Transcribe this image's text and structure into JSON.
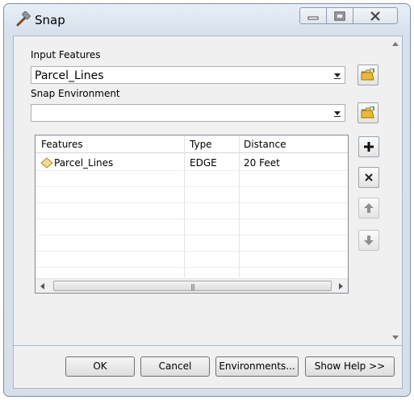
{
  "window": {
    "title": "Snap",
    "icon": "hammer-icon"
  },
  "controls": {
    "minimize": "minimize-icon",
    "maximize": "maximize-icon",
    "close": "close-icon"
  },
  "input_features": {
    "label": "Input Features",
    "value": "Parcel_Lines"
  },
  "snap_environment": {
    "label": "Snap Environment",
    "value": "",
    "columns": [
      "Features",
      "Type",
      "Distance"
    ],
    "rows": [
      {
        "feature": "Parcel_Lines",
        "type": "EDGE",
        "distance": "20 Feet",
        "icon": "line-layer-icon"
      }
    ]
  },
  "side_buttons": {
    "add": "plus-icon",
    "remove": "x-icon",
    "up": "arrow-up-icon",
    "down": "arrow-down-icon"
  },
  "buttons": {
    "ok": "OK",
    "cancel": "Cancel",
    "environments": "Environments...",
    "help": "Show Help >>"
  },
  "colors": {
    "window_frame": "#d6dfea",
    "client": "#f0f0f0",
    "folder": "#e8b93b",
    "layer_symbol": "#f5d98a"
  }
}
